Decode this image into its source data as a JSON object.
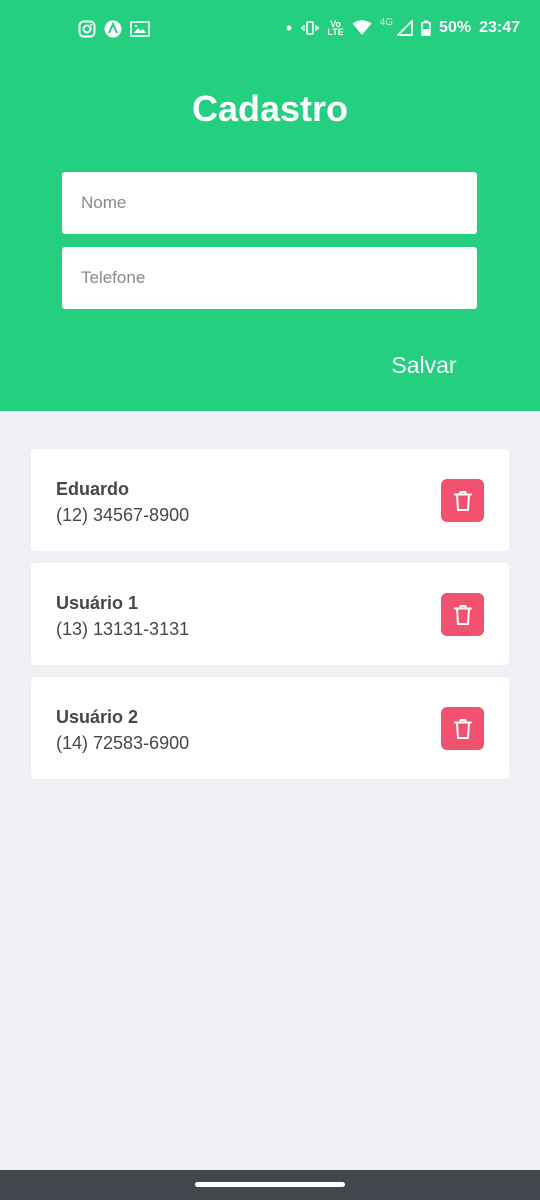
{
  "status_bar": {
    "network": "4G",
    "volte": "Vo",
    "lte": "LTE",
    "battery": "50%",
    "time": "23:47"
  },
  "header": {
    "title": "Cadastro",
    "name_placeholder": "Nome",
    "phone_placeholder": "Telefone",
    "save_label": "Salvar"
  },
  "contacts": [
    {
      "name": "Eduardo",
      "phone": "(12) 34567-8900"
    },
    {
      "name": "Usuário 1",
      "phone": "(13) 13131-3131"
    },
    {
      "name": "Usuário 2",
      "phone": "(14) 72583-6900"
    }
  ],
  "colors": {
    "header_green": "#24d07f",
    "delete_red": "#f2526f",
    "background": "#eff0f5"
  }
}
